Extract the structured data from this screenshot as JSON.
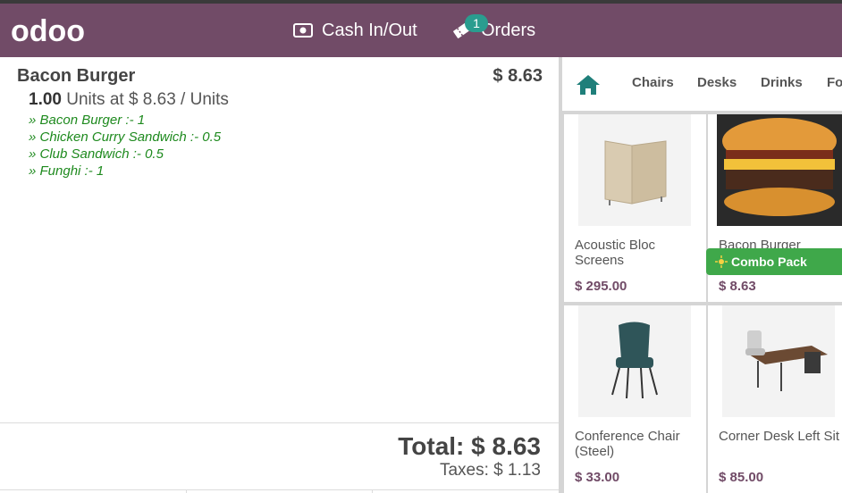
{
  "header": {
    "logo_text": "odoo",
    "cash_label": "Cash In/Out",
    "orders_label": "Orders",
    "orders_count": "1",
    "colors": {
      "brand": "#714b67",
      "badge": "#2a9d8f"
    }
  },
  "order": {
    "line": {
      "name": "Bacon Burger",
      "price": "$ 8.63",
      "qty": "1.00",
      "unit_text": "Units at $ 8.63 / Units",
      "combo_items": [
        "» Bacon Burger :- 1",
        "» Chicken Curry Sandwich :- 0.5",
        "» Club Sandwich :- 0.5",
        "» Funghi :- 1"
      ]
    },
    "total": "Total: $ 8.63",
    "taxes": "Taxes: $ 1.13"
  },
  "categories": {
    "home_icon": "home-icon",
    "items": [
      "Chairs",
      "Desks",
      "Drinks",
      "Fo"
    ]
  },
  "products": [
    {
      "name": "Acoustic Bloc Screens",
      "price": "$ 295.00"
    },
    {
      "name": "Bacon Burger",
      "price": "$ 8.63",
      "tag": "Combo Pack"
    },
    {
      "name": "Conference Chair (Steel)",
      "price": "$ 33.00"
    },
    {
      "name": "Corner Desk Left Sit",
      "price": "$ 85.00"
    }
  ]
}
